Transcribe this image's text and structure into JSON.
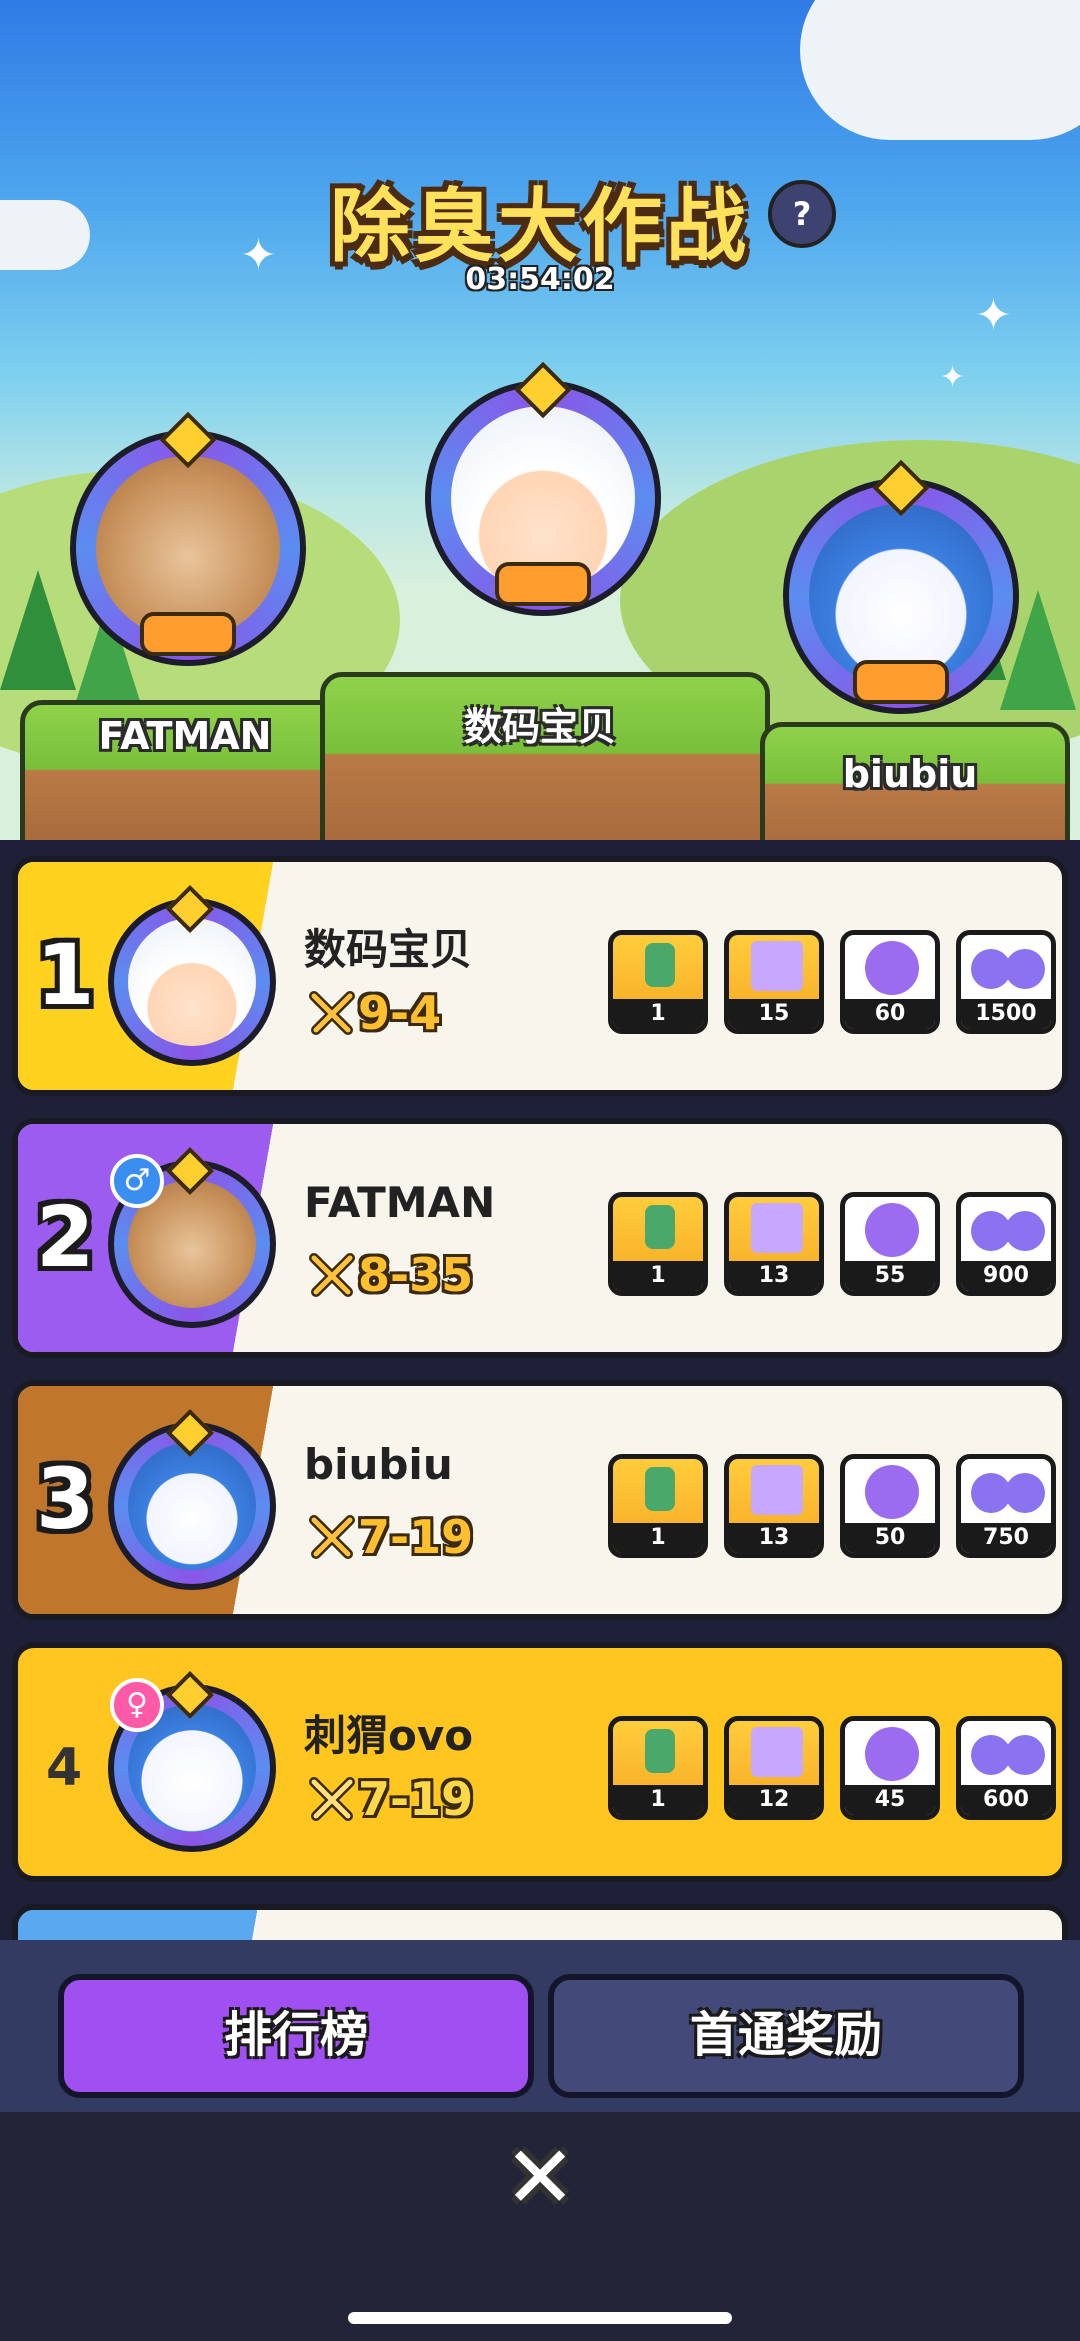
{
  "header": {
    "title": "除臭大作战",
    "help_icon": "?",
    "timer": "03:54:02"
  },
  "podium": [
    {
      "name": "FATMAN",
      "position": "left"
    },
    {
      "name": "数码宝贝",
      "position": "center"
    },
    {
      "name": "biubiu",
      "position": "right"
    }
  ],
  "leaderboard": [
    {
      "rank": "1",
      "name": "数码宝贝",
      "score": "9-4",
      "rewards": [
        "1",
        "15",
        "60",
        "1500"
      ]
    },
    {
      "rank": "2",
      "name": "FATMAN",
      "score": "8-35",
      "gender": "♂",
      "rewards": [
        "1",
        "13",
        "55",
        "900"
      ]
    },
    {
      "rank": "3",
      "name": "biubiu",
      "score": "7-19",
      "rewards": [
        "1",
        "13",
        "50",
        "750"
      ]
    },
    {
      "rank": "4",
      "name": "刺猬ovo",
      "score": "7-19",
      "gender": "♀",
      "rewards": [
        "1",
        "12",
        "45",
        "600"
      ]
    }
  ],
  "tabs": {
    "leaderboard": "排行榜",
    "first_clear": "首通奖励"
  },
  "close_label": "✕",
  "colors": {
    "rank1": "#ffd21f",
    "rank2": "#9d5cf0",
    "rank3": "#c0762b",
    "rank4_row": "#ffc61f",
    "tab_active": "#a04ff0",
    "tab_inactive": "#434a7a"
  }
}
